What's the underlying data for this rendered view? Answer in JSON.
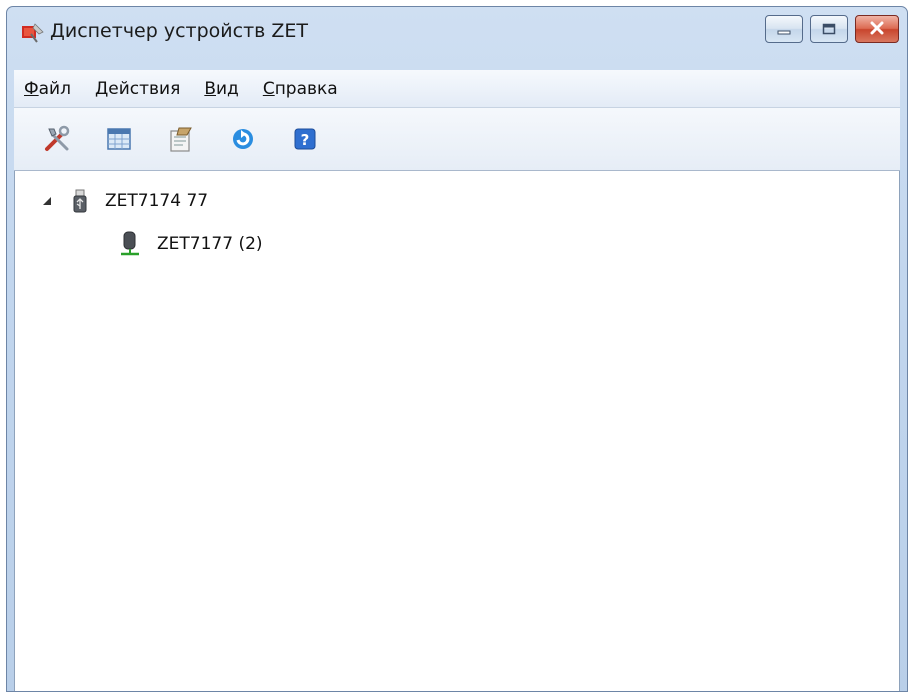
{
  "window": {
    "title": "Диспетчер устройств ZET",
    "icon": "device-manager-app-icon",
    "controls": {
      "minimize": "minimize-icon",
      "maximize": "maximize-icon",
      "close": "close-icon"
    }
  },
  "menu": {
    "items": [
      {
        "accel": "Ф",
        "rest": "айл"
      },
      {
        "accel": "Д",
        "rest": "ействия"
      },
      {
        "accel": "В",
        "rest": "ид"
      },
      {
        "accel": "С",
        "rest": "правка"
      }
    ]
  },
  "toolbar": {
    "buttons": [
      {
        "icon": "tools-icon"
      },
      {
        "icon": "table-icon"
      },
      {
        "icon": "properties-icon"
      },
      {
        "icon": "refresh-icon"
      },
      {
        "icon": "help-icon"
      }
    ]
  },
  "tree": {
    "root": {
      "label": "ZET7174 77",
      "icon": "usb-device-icon",
      "expanded": true,
      "children": [
        {
          "label": "ZET7177 (2)",
          "icon": "sensor-device-icon"
        }
      ]
    }
  },
  "colors": {
    "title_frame": "#c2d6ee",
    "close_button": "#c8452d",
    "help_blue": "#2f6fd0",
    "refresh_blue": "#2a8de0",
    "status_green": "#2aa02a"
  }
}
